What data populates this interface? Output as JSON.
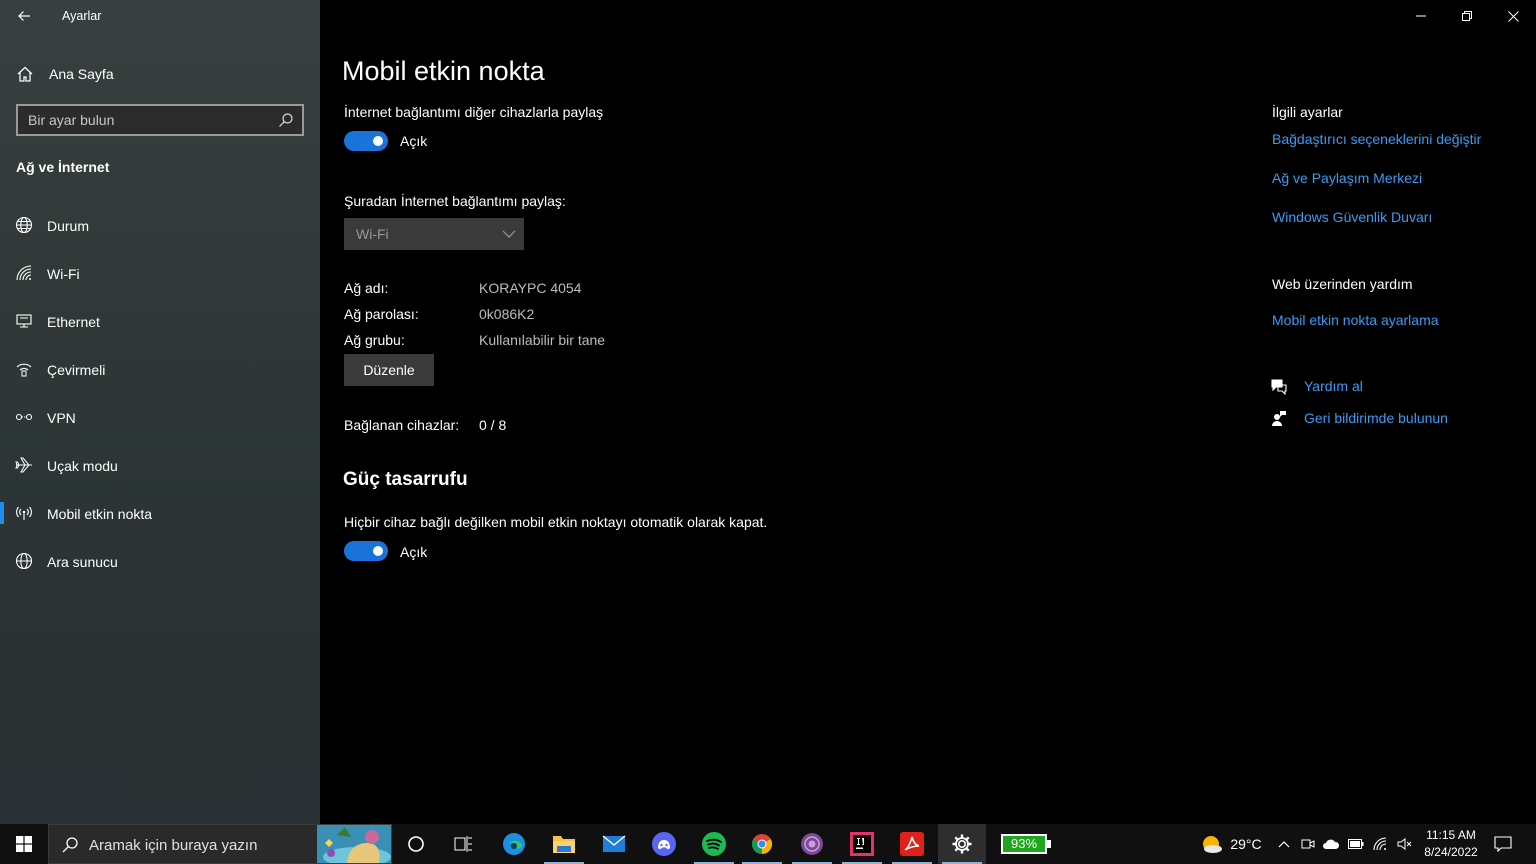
{
  "window": {
    "app_title": "Ayarlar"
  },
  "sidebar": {
    "home_label": "Ana Sayfa",
    "search_placeholder": "Bir ayar bulun",
    "section_title": "Ağ ve İnternet",
    "items": [
      {
        "label": "Durum",
        "icon": "globe-status-icon"
      },
      {
        "label": "Wi-Fi",
        "icon": "wifi-icon"
      },
      {
        "label": "Ethernet",
        "icon": "ethernet-icon"
      },
      {
        "label": "Çevirmeli",
        "icon": "dialup-icon"
      },
      {
        "label": "VPN",
        "icon": "vpn-icon"
      },
      {
        "label": "Uçak modu",
        "icon": "airplane-icon"
      },
      {
        "label": "Mobil etkin nokta",
        "icon": "hotspot-icon",
        "active": true
      },
      {
        "label": "Ara sunucu",
        "icon": "globe-icon"
      }
    ]
  },
  "main": {
    "title": "Mobil etkin nokta",
    "share_label": "İnternet bağlantımı diğer cihazlarla paylaş",
    "share_toggle_state": "Açık",
    "share_from_label": "Şuradan İnternet bağlantımı paylaş:",
    "share_from_value": "Wi-Fi",
    "network_name_label": "Ağ adı:",
    "network_name_value": "KORAYPC 4054",
    "network_password_label": "Ağ parolası:",
    "network_password_value": "0k086K2",
    "network_band_label": "Ağ grubu:",
    "network_band_value": "Kullanılabilir bir tane",
    "edit_button": "Düzenle",
    "connected_label": "Bağlanan cihazlar:",
    "connected_value": "0 / 8",
    "power_heading": "Güç tasarrufu",
    "power_desc": "Hiçbir cihaz bağlı değilken mobil etkin noktayı otomatik olarak kapat.",
    "power_toggle_state": "Açık"
  },
  "related": {
    "heading": "İlgili ayarlar",
    "links": [
      "Bağdaştırıcı seçeneklerini değiştir",
      "Ağ ve Paylaşım Merkezi",
      "Windows Güvenlik Duvarı"
    ],
    "web_heading": "Web üzerinden yardım",
    "web_links": [
      "Mobil etkin nokta ayarlama"
    ],
    "help_label": "Yardım al",
    "feedback_label": "Geri bildirimde bulunun"
  },
  "taskbar": {
    "search_placeholder": "Aramak için buraya yazın",
    "battery": "93%",
    "temperature": "29°C",
    "time": "11:15 AM",
    "date": "8/24/2022",
    "colors": {
      "accent": "#1a73d9",
      "link": "#3b9bf4",
      "battery_green": "#1fa51f"
    }
  }
}
